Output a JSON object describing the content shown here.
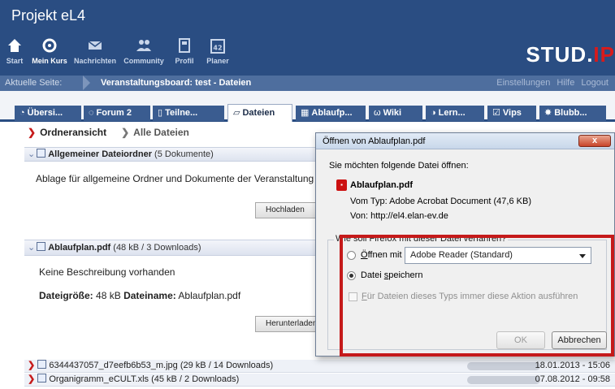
{
  "header": {
    "site_title": "Projekt eL4",
    "logo_main": "STUD.",
    "logo_accent": "IP",
    "nav": [
      {
        "label": "Start",
        "icon": "home-icon"
      },
      {
        "label": "Mein Kurs",
        "icon": "course-icon"
      },
      {
        "label": "Nachrichten",
        "icon": "mail-icon"
      },
      {
        "label": "Community",
        "icon": "people-icon"
      },
      {
        "label": "Profil",
        "icon": "profile-icon"
      },
      {
        "label": "Planer",
        "icon": "calendar-icon",
        "calendar_number": "42"
      }
    ]
  },
  "breadcrumb": {
    "label": "Aktuelle Seite:",
    "value": "Veranstaltungsboard: test - Dateien",
    "links": [
      "Einstellungen",
      "Hilfe",
      "Logout"
    ]
  },
  "tabs": [
    {
      "label": "Übersi...",
      "icon": "overview-icon"
    },
    {
      "label": "Forum 2",
      "icon": "forum-icon"
    },
    {
      "label": "Teilne...",
      "icon": "participants-icon"
    },
    {
      "label": "Dateien",
      "icon": "files-icon",
      "active": true
    },
    {
      "label": "Ablaufp...",
      "icon": "schedule-icon"
    },
    {
      "label": "Wiki",
      "icon": "wiki-icon"
    },
    {
      "label": "Lern...",
      "icon": "learn-icon"
    },
    {
      "label": "Vips",
      "icon": "vips-icon"
    },
    {
      "label": "Blubb...",
      "icon": "blubber-icon"
    }
  ],
  "viewnav": {
    "active": "Ordneransicht",
    "inactive": "Alle Dateien"
  },
  "folder": {
    "title": "Allgemeiner Dateiordner",
    "meta": "(5 Dokumente)",
    "description": "Ablage für allgemeine Ordner und Dokumente der Veranstaltung",
    "upload_button": "Hochladen"
  },
  "file_open": {
    "title": "Ablaufplan.pdf",
    "meta": "(48 kB / 3 Downloads)",
    "description": "Keine Beschreibung vorhanden",
    "size_label": "Dateigröße:",
    "size_value": "48 kB",
    "name_label": "Dateiname:",
    "name_value": "Ablaufplan.pdf",
    "download_button": "Herunterladen"
  },
  "file_rows": [
    {
      "name": "6344437057_d7eefb6b53_m.jpg",
      "meta": "(29 kB / 14 Downloads)",
      "date": "18.01.2013 - 15:06"
    },
    {
      "name": "Organigramm_eCULT.xls",
      "meta": "(45 kB / 2 Downloads)",
      "date": "07.08.2012 - 09:58"
    }
  ],
  "dialog": {
    "title": "Öffnen von Ablaufplan.pdf",
    "close": "x",
    "intro": "Sie möchten folgende Datei öffnen:",
    "filename": "Ablaufplan.pdf",
    "type_label": "Vom Typ:",
    "type_value": "Adobe Acrobat Document (47,6 KB)",
    "from_label": "Von:",
    "from_value": "http://el4.elan-ev.de",
    "question": "Wie soll Firefox mit dieser Datei verfahren?",
    "open_with_prefix": "Ö",
    "open_with_rest": "ffnen mit",
    "app_selected": "Adobe Reader  (Standard)",
    "save_prefix": "Datei ",
    "save_key": "s",
    "save_rest": "peichern",
    "always_key": "F",
    "always_rest": "ür Dateien dieses Typs immer diese Aktion ausführen",
    "ok": "OK",
    "cancel": "Abbrechen"
  }
}
